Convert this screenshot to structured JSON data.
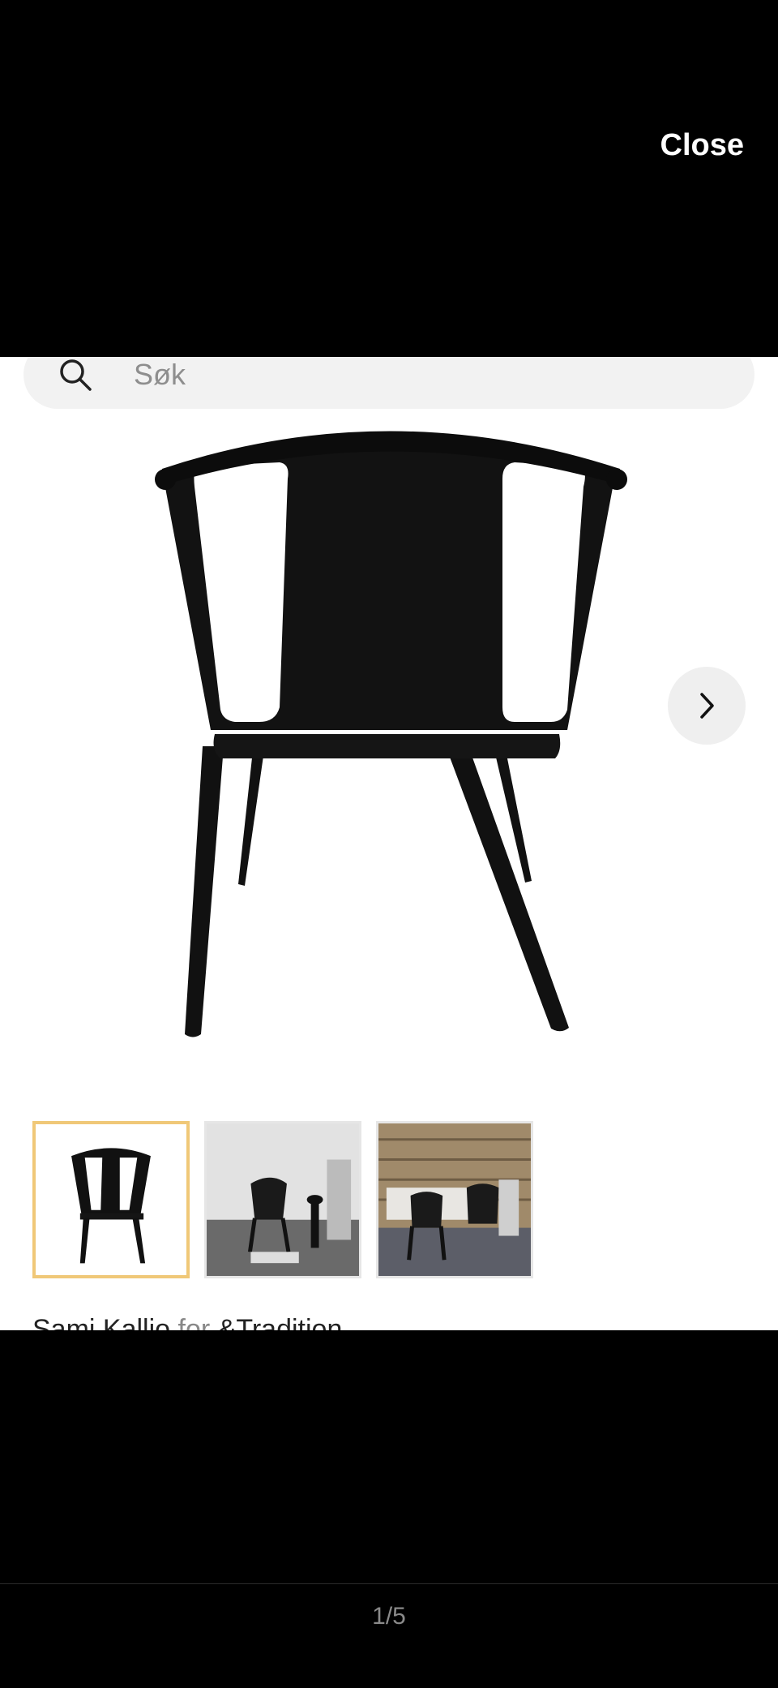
{
  "header": {
    "close_label": "Close"
  },
  "search": {
    "placeholder": "Søk"
  },
  "caption": {
    "designer": "Sami Kallio",
    "connector": "for",
    "brand": "&Tradition"
  },
  "pager": {
    "counter": "1/5"
  },
  "colors": {
    "active_thumb_border": "#f0c878",
    "chair": "#111111"
  },
  "icons": {
    "search": "search-icon",
    "next": "chevron-right-icon"
  }
}
